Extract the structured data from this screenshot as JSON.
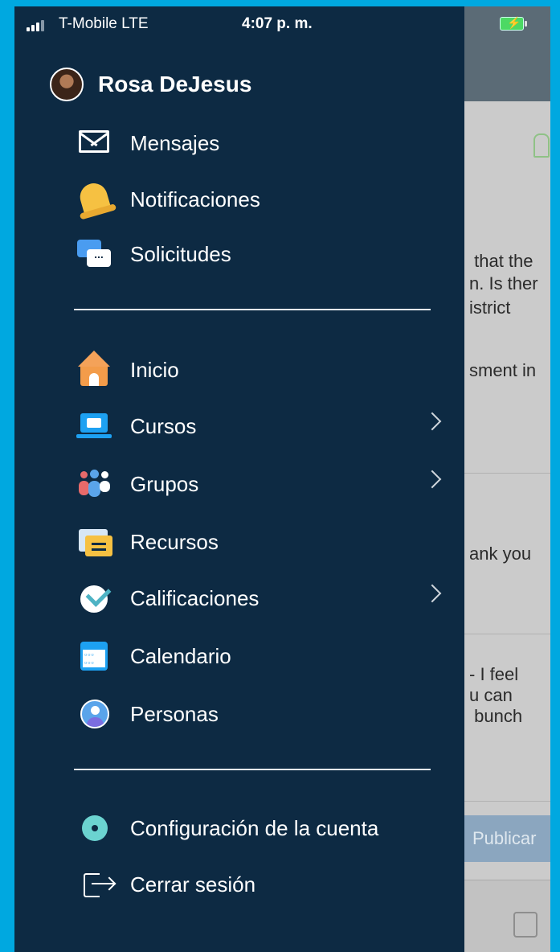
{
  "status_bar": {
    "carrier": "T-Mobile  LTE",
    "time": "4:07 p. m."
  },
  "profile": {
    "name": "Rosa DeJesus"
  },
  "menu": {
    "group1": [
      {
        "label": "Mensajes",
        "icon": "envelope-icon"
      },
      {
        "label": "Notificaciones",
        "icon": "bell-icon"
      },
      {
        "label": "Solicitudes",
        "icon": "chat-bubbles-icon"
      }
    ],
    "group2": [
      {
        "label": "Inicio",
        "icon": "home-icon"
      },
      {
        "label": "Cursos",
        "icon": "laptop-book-icon",
        "has_submenu": true
      },
      {
        "label": "Grupos",
        "icon": "people-group-icon",
        "has_submenu": true
      },
      {
        "label": "Recursos",
        "icon": "folder-icon"
      },
      {
        "label": "Calificaciones",
        "icon": "checkmark-icon",
        "has_submenu": true
      },
      {
        "label": "Calendario",
        "icon": "calendar-icon"
      },
      {
        "label": "Personas",
        "icon": "person-icon"
      }
    ],
    "group3": [
      {
        "label": "Configuración de la cuenta",
        "icon": "gear-icon"
      },
      {
        "label": "Cerrar sesión",
        "icon": "logout-icon"
      }
    ]
  },
  "background_app": {
    "text_lines": [
      " that the",
      "n. Is ther",
      "istrict",
      "sment in",
      "ank you",
      "- I feel",
      "u can",
      " bunch"
    ],
    "publish_button": "Publicar"
  },
  "colors": {
    "drawer": "#0d2a43",
    "frame": "#00a8e0"
  }
}
